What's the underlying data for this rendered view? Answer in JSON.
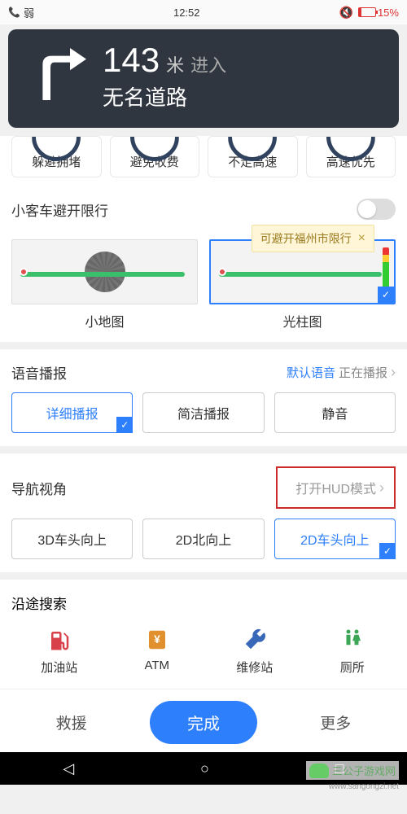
{
  "status": {
    "signal": "弱",
    "time": "12:52",
    "battery_pct": "15%"
  },
  "nav": {
    "distance": "143",
    "unit": "米",
    "enter": "进入",
    "road": "无名道路"
  },
  "prefs": [
    "躲避拥堵",
    "避免收费",
    "不走高速",
    "高速优先"
  ],
  "restrict": {
    "label": "小客车避开限行"
  },
  "hint": {
    "text": "可避开福州市限行",
    "close": "×"
  },
  "map_modes": {
    "mini": "小地图",
    "beam": "光柱图"
  },
  "voice": {
    "title": "语音播报",
    "link_prefix": "默认语音",
    "link_suffix": "正在播报",
    "opts": [
      "详细播报",
      "简洁播报",
      "静音"
    ]
  },
  "view": {
    "title": "导航视角",
    "hud": "打开HUD模式",
    "opts": [
      "3D车头向上",
      "2D北向上",
      "2D车头向上"
    ]
  },
  "search": {
    "title": "沿途搜索",
    "pois": {
      "gas": "加油站",
      "atm": "ATM",
      "repair": "维修站",
      "toilet": "厕所"
    }
  },
  "bottom": {
    "rescue": "救援",
    "done": "完成",
    "more": "更多"
  },
  "watermark": {
    "text": "三公子游戏网",
    "url": "www.sangongzi.net"
  }
}
